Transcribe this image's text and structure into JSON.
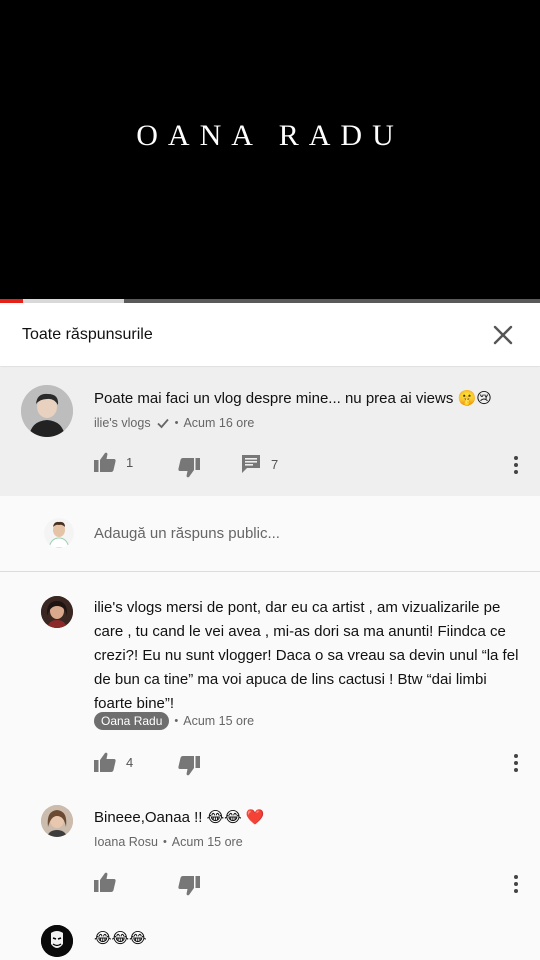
{
  "video": {
    "title": "OANA RADU",
    "progress_played": 0.042,
    "progress_buffered": 0.23
  },
  "panel": {
    "title": "Toate răspunsurile",
    "close_icon": "close-icon"
  },
  "colors": {
    "progress_red": "#e62117",
    "highlight_bg": "#efefef",
    "badge_bg": "#6e6e6e"
  },
  "top_comment": {
    "text": "Poate mai faci un vlog despre mine... nu prea ai views 🤫😢",
    "author": "ilie's vlogs",
    "verified": true,
    "time": "Acum 16 ore",
    "likes": "1",
    "replies": "7"
  },
  "reply_box": {
    "placeholder": "Adaugă un răspuns public..."
  },
  "replies": [
    {
      "text": "ilie's vlogs mersi de pont, dar eu ca artist , am vizualizarile pe care , tu cand le vei avea , mi-as dori sa ma anunti! Fiindca ce crezi?! Eu nu sunt vlogger! Daca o sa vreau sa devin unul “la fel de bun ca tine” ma voi apuca de lins cactusi ! Btw “dai limbi foarte bine”!",
      "author": "Oana Radu",
      "author_is_creator": true,
      "time": "Acum 15 ore",
      "likes": "4"
    },
    {
      "text": "Bineee,Oanaa !! 😂😂 ❤️",
      "author": "Ioana Rosu",
      "time": "Acum 15 ore",
      "likes": ""
    },
    {
      "text": "😂😂😂",
      "author": "",
      "time": "",
      "likes": ""
    }
  ]
}
